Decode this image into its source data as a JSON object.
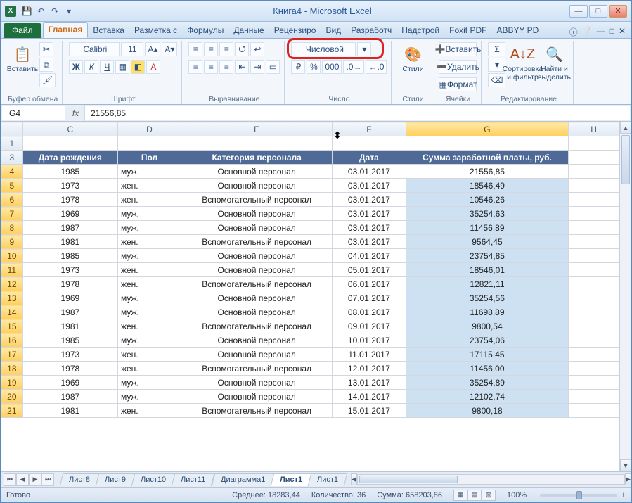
{
  "title": "Книга4 - Microsoft Excel",
  "tabs": {
    "file": "Файл",
    "home": "Главная",
    "insert": "Вставка",
    "layout": "Разметка с",
    "formulas": "Формулы",
    "data": "Данные",
    "review": "Рецензиро",
    "view": "Вид",
    "dev": "Разработч",
    "addins": "Надстрой",
    "foxit": "Foxit PDF",
    "abbyy": "ABBYY PD"
  },
  "ribbon": {
    "paste": "Вставить",
    "clipboard": "Буфер обмена",
    "font_name": "Calibri",
    "font_size": "11",
    "font_grp": "Шрифт",
    "align_grp": "Выравнивание",
    "numfmt": "Числовой",
    "num_grp": "Число",
    "styles": "Стили",
    "insert": "Вставить",
    "delete": "Удалить",
    "format": "Формат",
    "cells_grp": "Ячейки",
    "sort": "Сортировка и фильтр",
    "find": "Найти и выделить",
    "edit_grp": "Редактирование"
  },
  "namebox": "G4",
  "formula": "21556,85",
  "cols": [
    "C",
    "D",
    "E",
    "F",
    "G",
    "H"
  ],
  "selcol": "G",
  "selrows": [
    4,
    5,
    6,
    7,
    8,
    9,
    10,
    11,
    12,
    13,
    14,
    15,
    16,
    17,
    18,
    19,
    20,
    21
  ],
  "headers": {
    "C": "Дата рождения",
    "D": "Пол",
    "E": "Категория персонала",
    "F": "Дата",
    "G": "Сумма заработной платы, руб."
  },
  "rows": [
    {
      "n": 4,
      "C": "1985",
      "D": "муж.",
      "E": "Основной персонал",
      "F": "03.01.2017",
      "G": "21556,85"
    },
    {
      "n": 5,
      "C": "1973",
      "D": "жен.",
      "E": "Основной персонал",
      "F": "03.01.2017",
      "G": "18546,49"
    },
    {
      "n": 6,
      "C": "1978",
      "D": "жен.",
      "E": "Вспомогательный персонал",
      "F": "03.01.2017",
      "G": "10546,26"
    },
    {
      "n": 7,
      "C": "1969",
      "D": "муж.",
      "E": "Основной персонал",
      "F": "03.01.2017",
      "G": "35254,63"
    },
    {
      "n": 8,
      "C": "1987",
      "D": "муж.",
      "E": "Основной персонал",
      "F": "03.01.2017",
      "G": "11456,89"
    },
    {
      "n": 9,
      "C": "1981",
      "D": "жен.",
      "E": "Вспомогательный персонал",
      "F": "03.01.2017",
      "G": "9564,45"
    },
    {
      "n": 10,
      "C": "1985",
      "D": "муж.",
      "E": "Основной персонал",
      "F": "04.01.2017",
      "G": "23754,85"
    },
    {
      "n": 11,
      "C": "1973",
      "D": "жен.",
      "E": "Основной персонал",
      "F": "05.01.2017",
      "G": "18546,01"
    },
    {
      "n": 12,
      "C": "1978",
      "D": "жен.",
      "E": "Вспомогательный персонал",
      "F": "06.01.2017",
      "G": "12821,11"
    },
    {
      "n": 13,
      "C": "1969",
      "D": "муж.",
      "E": "Основной персонал",
      "F": "07.01.2017",
      "G": "35254,56"
    },
    {
      "n": 14,
      "C": "1987",
      "D": "муж.",
      "E": "Основной персонал",
      "F": "08.01.2017",
      "G": "11698,89"
    },
    {
      "n": 15,
      "C": "1981",
      "D": "жен.",
      "E": "Вспомогательный персонал",
      "F": "09.01.2017",
      "G": "9800,54"
    },
    {
      "n": 16,
      "C": "1985",
      "D": "муж.",
      "E": "Основной персонал",
      "F": "10.01.2017",
      "G": "23754,06"
    },
    {
      "n": 17,
      "C": "1973",
      "D": "жен.",
      "E": "Основной персонал",
      "F": "11.01.2017",
      "G": "17115,45"
    },
    {
      "n": 18,
      "C": "1978",
      "D": "жен.",
      "E": "Вспомогательный персонал",
      "F": "12.01.2017",
      "G": "11456,00"
    },
    {
      "n": 19,
      "C": "1969",
      "D": "муж.",
      "E": "Основной персонал",
      "F": "13.01.2017",
      "G": "35254,89"
    },
    {
      "n": 20,
      "C": "1987",
      "D": "муж.",
      "E": "Основной персонал",
      "F": "14.01.2017",
      "G": "12102,74"
    },
    {
      "n": 21,
      "C": "1981",
      "D": "жен.",
      "E": "Вспомогательный персонал",
      "F": "15.01.2017",
      "G": "9800,18"
    }
  ],
  "sheet_tabs": [
    "Лист8",
    "Лист9",
    "Лист10",
    "Лист11",
    "Диаграмма1",
    "Лист1",
    "Лист1"
  ],
  "active_sheet": 5,
  "status": {
    "ready": "Готово",
    "avg_l": "Среднее:",
    "avg": "18283,44",
    "cnt_l": "Количество:",
    "cnt": "36",
    "sum_l": "Сумма:",
    "sum": "658203,86",
    "zoom": "100%"
  }
}
